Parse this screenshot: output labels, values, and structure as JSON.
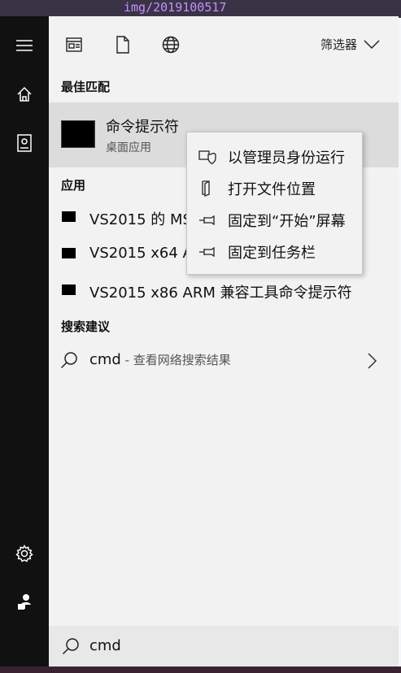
{
  "background": {
    "url_text": "img/2019100517"
  },
  "rail": {
    "icons": [
      "hamburger-menu-icon",
      "home-icon",
      "document-library-icon",
      "gear-icon",
      "user-account-icon"
    ]
  },
  "toolbar": {
    "filter_label": "筛选器",
    "tab_icons": [
      "apps-icon",
      "document-icon",
      "web-globe-icon"
    ]
  },
  "best_match": {
    "header": "最佳匹配",
    "title": "命令提示符",
    "subtitle": "桌面应用"
  },
  "apps": {
    "header": "应用",
    "items": [
      {
        "label": "VS2015 的 MS"
      },
      {
        "label": "VS2015 x64 A"
      },
      {
        "label": "VS2015 x86 ARM 兼容工具命令提示符"
      }
    ]
  },
  "suggestions": {
    "header": "搜索建议",
    "query": "cmd",
    "sub": " - 查看网络搜索结果"
  },
  "search": {
    "value": "cmd"
  },
  "context_menu": {
    "items": [
      {
        "label": "以管理员身份运行",
        "icon": "admin-shield-icon"
      },
      {
        "label": "打开文件位置",
        "icon": "open-file-location-icon"
      },
      {
        "label": "固定到“开始”屏幕",
        "icon": "pin-icon"
      },
      {
        "label": "固定到任务栏",
        "icon": "pin-icon"
      }
    ]
  },
  "colors": {
    "panel": "#f2f2f2",
    "rail": "#111111",
    "highlight": "#dcdcdc"
  }
}
